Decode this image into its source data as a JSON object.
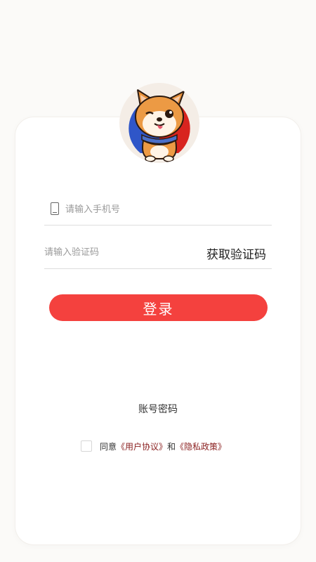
{
  "avatar": {
    "icon": "shiba-dog-mascot-icon"
  },
  "phone_field": {
    "placeholder": "请输入手机号",
    "value": "",
    "icon": "phone-icon"
  },
  "code_field": {
    "placeholder": "请输入验证码",
    "value": "",
    "action_label": "获取验证码"
  },
  "login_button": {
    "label": "登录",
    "color": "#f4413e"
  },
  "account_login": {
    "label": "账号密码"
  },
  "agreement": {
    "prefix": "同意",
    "user_agreement": "《用户协议》",
    "connector": "和",
    "privacy_policy": "《隐私政策》",
    "checked": false,
    "link_color": "#8a1f1f"
  }
}
